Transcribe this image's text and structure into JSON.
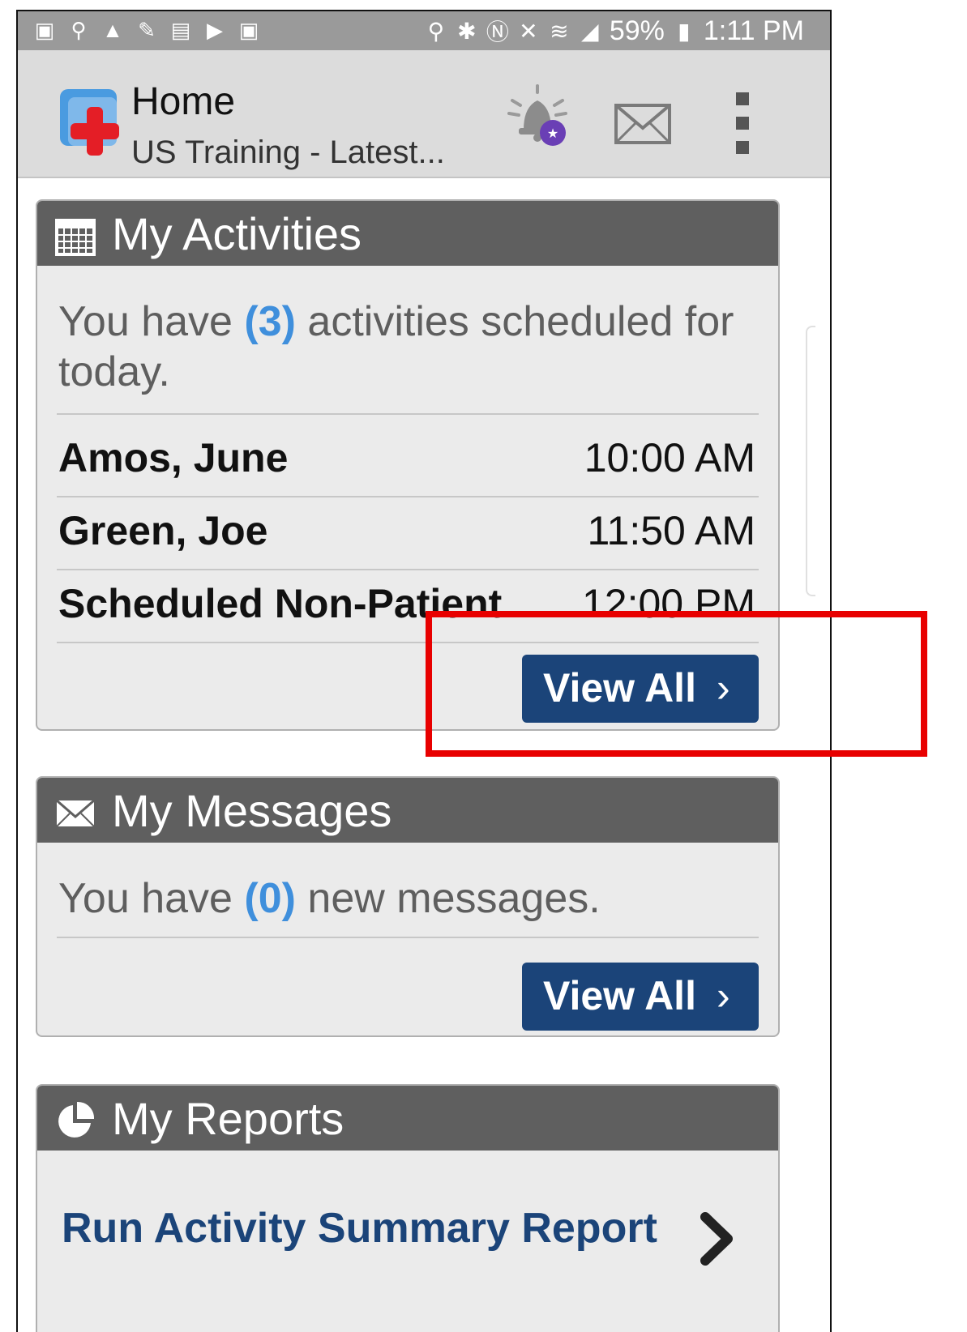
{
  "status_bar": {
    "battery": "59%",
    "time": "1:11 PM",
    "icons": [
      "notification-icon",
      "bluetooth-icon",
      "nfc-icon",
      "mute-icon",
      "wifi-icon",
      "signal-icon",
      "battery-icon",
      "location-icon"
    ]
  },
  "app_bar": {
    "title": "Home",
    "subtitle": "US Training - Latest...",
    "icons": [
      "app-logo",
      "notification-bell-icon",
      "mail-icon",
      "overflow-menu-icon"
    ]
  },
  "activities": {
    "title": "My Activities",
    "intro_prefix": "You have ",
    "count": "(3)",
    "intro_suffix": " activities scheduled for today.",
    "rows": [
      {
        "name": "Amos, June",
        "time": "10:00 AM"
      },
      {
        "name": "Green, Joe",
        "time": "11:50 AM"
      },
      {
        "name": "Scheduled Non-Patient...",
        "time": "12:00 PM"
      }
    ],
    "view_all": "View All",
    "chevron": "›"
  },
  "messages": {
    "title": "My Messages",
    "intro_prefix": "You have ",
    "count": "(0)",
    "intro_suffix": " new messages.",
    "view_all": "View All",
    "chevron": "›"
  },
  "reports": {
    "title": "My Reports",
    "link": "Run Activity Summary Report"
  },
  "colors": {
    "header": "#5f5f5f",
    "button": "#1b4479",
    "count": "#3f8fdc",
    "highlight": "#e80000"
  }
}
